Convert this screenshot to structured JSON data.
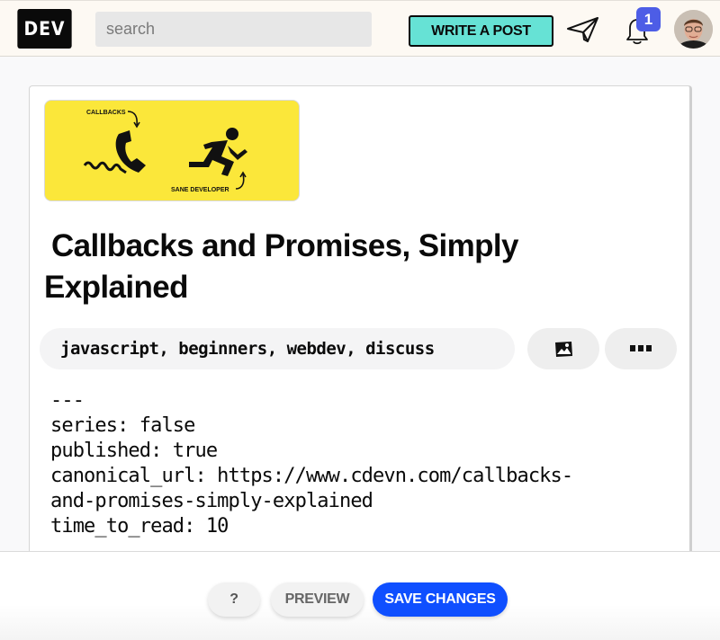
{
  "nav": {
    "logo": "DEV",
    "search_placeholder": "search",
    "write_post_label": "WRITE A POST",
    "notification_count": "1",
    "icons": {
      "send": "paper-plane-icon",
      "notifications": "bell-icon",
      "avatar": "user-avatar"
    }
  },
  "editor": {
    "cover_image": {
      "label_top": "CALLBACKS",
      "label_bottom": "SANE DEVELOPER",
      "background": "#fbe73a"
    },
    "title": "Callbacks and Promises, Simply Explained",
    "tags": "javascript, beginners, webdev, discuss",
    "image_upload_icon": "image-icon",
    "more_icon": "more-horizontal-icon",
    "body": "---\nseries: false\npublished: true\ncanonical_url: https://www.cdevn.com/callbacks-\nand-promises-simply-explained\ntime_to_read: 10"
  },
  "actions": {
    "help_label": "?",
    "preview_label": "PREVIEW",
    "save_label": "SAVE CHANGES"
  },
  "colors": {
    "accent_write": "#66e2d5",
    "save_blue": "#0f4fff",
    "badge": "#4d5de6"
  }
}
